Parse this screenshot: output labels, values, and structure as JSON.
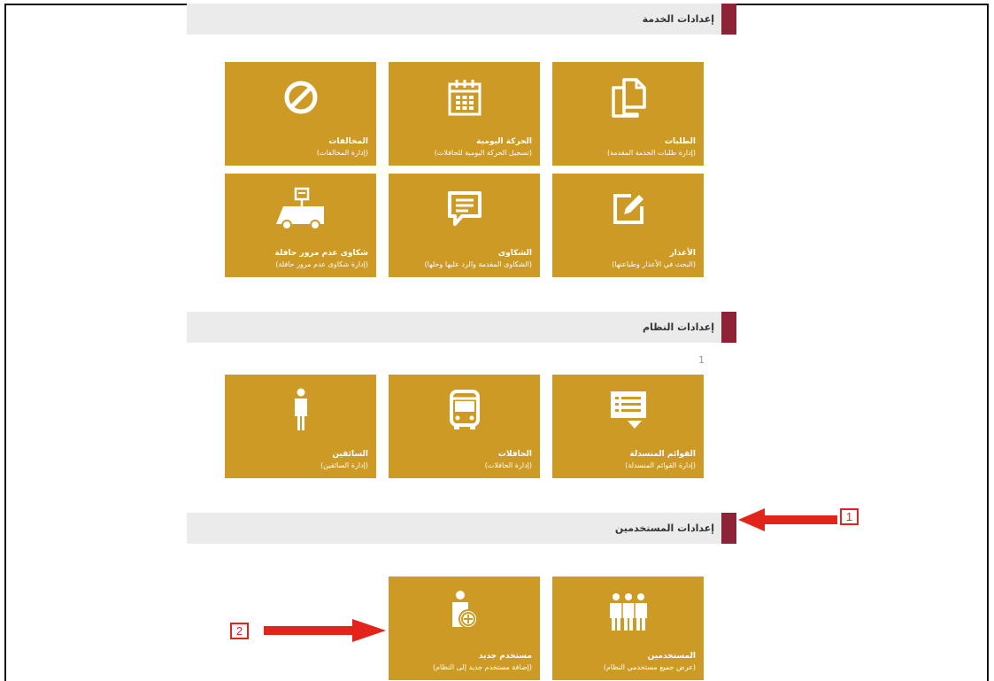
{
  "sections": {
    "service": {
      "title": "إعدادات الخدمة"
    },
    "system": {
      "title": "إعدادات النظام"
    },
    "users": {
      "title": "إعدادات المستخدمين"
    }
  },
  "tiles": {
    "requests": {
      "title": "الطلبات",
      "subtitle": "(إدارة طلبات الخدمة المقدمة)",
      "icon": "copy-icon"
    },
    "daily": {
      "title": "الحركة اليومية",
      "subtitle": "(تسجيل الحركة اليومية للحافلات)",
      "icon": "calendar-icon"
    },
    "violations": {
      "title": "المخالفات",
      "subtitle": "(إدارة المخالفات)",
      "icon": "ban-icon"
    },
    "excuses": {
      "title": "الأعذار",
      "subtitle": "(البحث في الأعذار وطباعتها)",
      "icon": "edit-icon"
    },
    "complaints": {
      "title": "الشكاوى",
      "subtitle": "(الشكاوى المقدمة والرد عليها وحلها)",
      "icon": "chat-icon"
    },
    "bus_complaints": {
      "title": "شكاوى عدم مرور حافلة",
      "subtitle": "(إدارة شكاوى عدم مرور حافلة)",
      "icon": "bus-stop-icon"
    },
    "lists": {
      "title": "القوائم المنسدلة",
      "subtitle": "(إدارة القوائم المنسدلة)",
      "icon": "list-icon"
    },
    "buses": {
      "title": "الحافلات",
      "subtitle": "(إدارة الحافلات)",
      "icon": "bus-icon"
    },
    "drivers": {
      "title": "السائقين",
      "subtitle": "(إدارة السائقين)",
      "icon": "person-icon"
    },
    "users_list": {
      "title": "المستخدمين",
      "subtitle": "(عرض جميع مستخدمي النظام)",
      "icon": "group-icon"
    },
    "new_user": {
      "title": "مستخدم جديد",
      "subtitle": "(إضافة مستخدم جديد إلى النظام)",
      "icon": "add-user-icon"
    }
  },
  "page_number": "1",
  "callouts": {
    "one": "1",
    "two": "2"
  },
  "colors": {
    "tile": "#cd9a26",
    "accent": "#8f2236",
    "header_bg": "#ebebeb",
    "annotation": "#e3241b"
  }
}
